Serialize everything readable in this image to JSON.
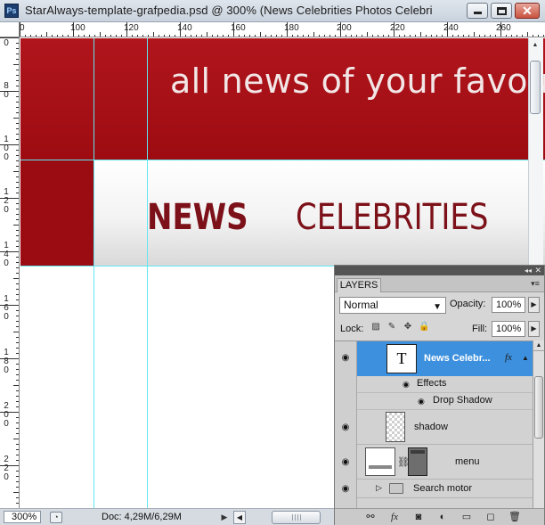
{
  "window": {
    "title": "StarAlways-template-grafpedia.psd @ 300% (News      Celebrities      Photos      Celebri",
    "app_icon": "Ps",
    "buttons": {
      "minimize": "minimize-icon",
      "maximize": "maximize-icon",
      "close": "✕"
    }
  },
  "ruler": {
    "top_labels": [
      "0",
      "100",
      "120",
      "140",
      "160",
      "180",
      "200",
      "220",
      "240",
      "260"
    ],
    "left_labels": [
      [
        "0"
      ],
      [
        "8",
        "0"
      ],
      [
        "1",
        "0",
        "0"
      ],
      [
        "1",
        "2",
        "0"
      ],
      [
        "1",
        "4",
        "0"
      ],
      [
        "1",
        "6",
        "0"
      ],
      [
        "1",
        "8",
        "0"
      ],
      [
        "2",
        "0",
        "0"
      ],
      [
        "2",
        "2",
        "0"
      ]
    ]
  },
  "canvas": {
    "tagline": "all news of your favour",
    "menu": {
      "news": "NEWS",
      "celebrities": "CELEBRITIES"
    },
    "colors": {
      "header": "#a50f16",
      "menu_text": "#7d1119",
      "guide": "#5ee7f2"
    }
  },
  "status": {
    "zoom": "300%",
    "doc": "Doc: 4,29M/6,29M",
    "play": "▶",
    "scroll_left": "◀"
  },
  "layers_panel": {
    "tab": "LAYERS",
    "blend_mode": "Normal",
    "opacity_label": "Opacity:",
    "opacity_value": "100%",
    "lock_label": "Lock:",
    "fill_label": "Fill:",
    "fill_value": "100%",
    "arrow_right": "▶",
    "dropdown_arrow": "▼",
    "layers": {
      "selected": {
        "thumb": "T",
        "name": "News     Celebr...",
        "fx": "fx"
      },
      "effects_label": "Effects",
      "drop_shadow_label": "Drop Shadow",
      "shadow": "shadow",
      "menu": "menu",
      "search_motor": "Search motor"
    },
    "eye_glyph": "👁",
    "footer_icons": [
      "link-icon",
      "fx-icon",
      "mask-icon",
      "adjustment-icon",
      "group-icon",
      "new-layer-icon",
      "trash-icon"
    ],
    "footer_glyphs": [
      "⚯",
      "fx",
      "◙",
      "◐",
      "▭",
      "◻",
      "🗑"
    ]
  }
}
